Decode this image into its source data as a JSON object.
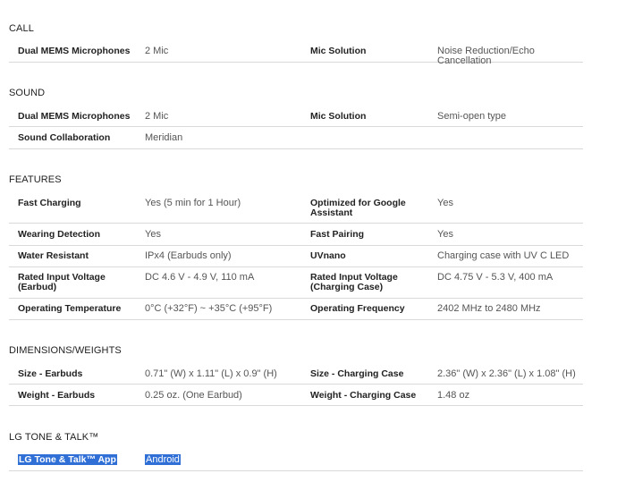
{
  "sections": [
    {
      "title": "CALL",
      "rows": [
        {
          "l1": "Dual MEMS Microphones",
          "v1": "2 Mic",
          "l2": "Mic Solution",
          "v2": "Noise Reduction/Echo Cancellation"
        }
      ]
    },
    {
      "title": "SOUND",
      "rows": [
        {
          "l1": "Dual MEMS Microphones",
          "v1": "2 Mic",
          "l2": "Mic Solution",
          "v2": "Semi-open type"
        },
        {
          "l1": "Sound Collaboration",
          "v1": "Meridian",
          "l2": "",
          "v2": ""
        }
      ]
    },
    {
      "title": "FEATURES",
      "rows": [
        {
          "l1": "Fast Charging",
          "v1": "Yes (5 min for 1 Hour)",
          "l2": "Optimized for Google Assistant",
          "v2": "Yes"
        },
        {
          "l1": "Wearing Detection",
          "v1": "Yes",
          "l2": "Fast Pairing",
          "v2": "Yes"
        },
        {
          "l1": "Water Resistant",
          "v1": "IPx4 (Earbuds only)",
          "l2": "UVnano",
          "v2": "Charging case with UV C LED"
        },
        {
          "l1": "Rated Input Voltage (Earbud)",
          "v1": "DC 4.6 V - 4.9 V, 110 mA",
          "l2": "Rated Input Voltage (Charging Case)",
          "v2": "DC 4.75 V - 5.3 V, 400 mA"
        },
        {
          "l1": "Operating Temperature",
          "v1": "0°C (+32°F) ~ +35°C (+95°F)",
          "l2": "Operating Frequency",
          "v2": "2402 MHz to 2480 MHz"
        }
      ]
    },
    {
      "title": "DIMENSIONS/WEIGHTS",
      "rows": [
        {
          "l1": "Size - Earbuds",
          "v1": "0.71\" (W) x 1.11\" (L) x 0.9\" (H)",
          "l2": "Size - Charging Case",
          "v2": "2.36\" (W) x 2.36\" (L) x 1.08\" (H)"
        },
        {
          "l1": "Weight - Earbuds",
          "v1": "0.25 oz. (One Earbud)",
          "l2": "Weight - Charging Case",
          "v2": "1.48 oz"
        }
      ]
    },
    {
      "title": "LG TONE & TALK™",
      "rows": [
        {
          "l1": "LG Tone & Talk™ App",
          "v1": "Android",
          "l2": "",
          "v2": "",
          "selected": true
        }
      ]
    }
  ],
  "colors": {
    "selection": "#2f6fd6",
    "divider": "#d9d9d9"
  }
}
